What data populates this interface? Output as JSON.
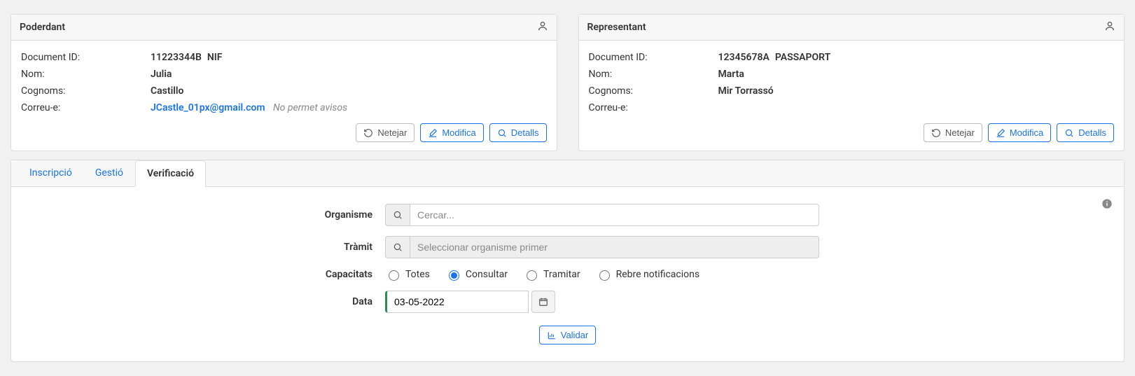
{
  "poderdant": {
    "title": "Poderdant",
    "labels": {
      "doc": "Document ID:",
      "nom": "Nom:",
      "cognoms": "Cognoms:",
      "correu": "Correu-e:"
    },
    "doc_id": "11223344B",
    "doc_type": "NIF",
    "nom": "Julia",
    "cognoms": "Castillo",
    "correu": "JCastle_01px@gmail.com",
    "correu_note": "No permet avisos"
  },
  "representant": {
    "title": "Representant",
    "labels": {
      "doc": "Document ID:",
      "nom": "Nom:",
      "cognoms": "Cognoms:",
      "correu": "Correu-e:"
    },
    "doc_id": "12345678A",
    "doc_type": "PASSAPORT",
    "nom": "Marta",
    "cognoms": "Mir Torrassó",
    "correu": ""
  },
  "actions": {
    "netejar": "Netejar",
    "modifica": "Modifica",
    "detalls": "Detalls"
  },
  "tabs": {
    "inscripcio": "Inscripció",
    "gestio": "Gestió",
    "verificacio": "Verificació"
  },
  "form": {
    "organisme_label": "Organisme",
    "organisme_placeholder": "Cercar...",
    "tramit_label": "Tràmit",
    "tramit_placeholder": "Seleccionar organisme primer",
    "capacitats_label": "Capacitats",
    "capacitats": {
      "totes": "Totes",
      "consultar": "Consultar",
      "tramitar": "Tramitar",
      "rebre": "Rebre notificacions"
    },
    "data_label": "Data",
    "data_value": "03-05-2022",
    "validar": "Validar"
  }
}
